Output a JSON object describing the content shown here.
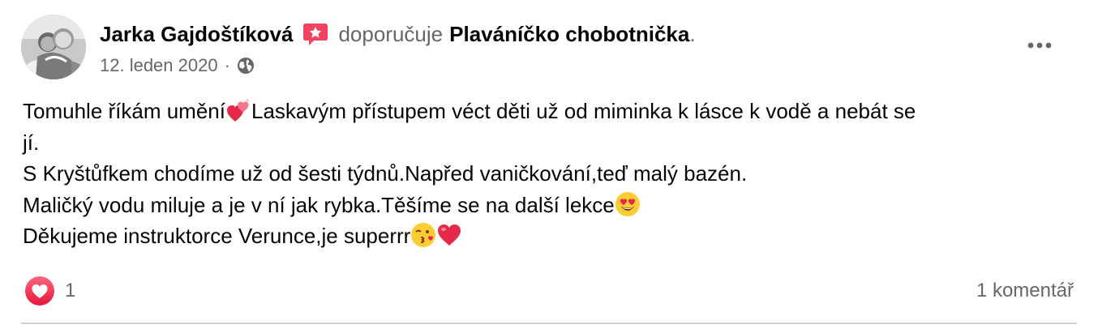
{
  "post": {
    "author": "Jarka Gajdoštíková",
    "action": "doporučuje",
    "page_name": "Plaváníčko chobotnička",
    "period": ".",
    "date": "12. leden 2020",
    "separator": "·",
    "privacy_icon": "globe-icon",
    "more_icon": "more-horizontal-icon",
    "recommend_icon": "recommend-badge-icon",
    "body_lines": [
      {
        "before": "Tomuhle říkám umění",
        "emoji": "sparkling-heart-emoji",
        "after": "Laskavým přístupem véct děti už od miminka k lásce k vodě a nebát se"
      },
      {
        "text": "jí."
      },
      {
        "text": "S Kryštůfkem chodíme už od šesti týdnů.Napřed vaničkování,teď malý bazén."
      },
      {
        "before": "Maličký vodu miluje a je v ní jak rybka.Těšíme se na další lekce",
        "emoji": "heart-eyes-emoji"
      },
      {
        "before": "Děkujeme instruktorce Verunce,je superrr",
        "emoji": "kiss-emoji",
        "emoji2": "red-heart-emoji"
      }
    ],
    "reaction_icon": "love-reaction-icon",
    "reaction_count": "1",
    "comments": "1 komentář"
  },
  "colors": {
    "text_primary": "#050505",
    "text_secondary": "#65676b",
    "badge": "#f3425f",
    "divider": "#ced0d4"
  }
}
